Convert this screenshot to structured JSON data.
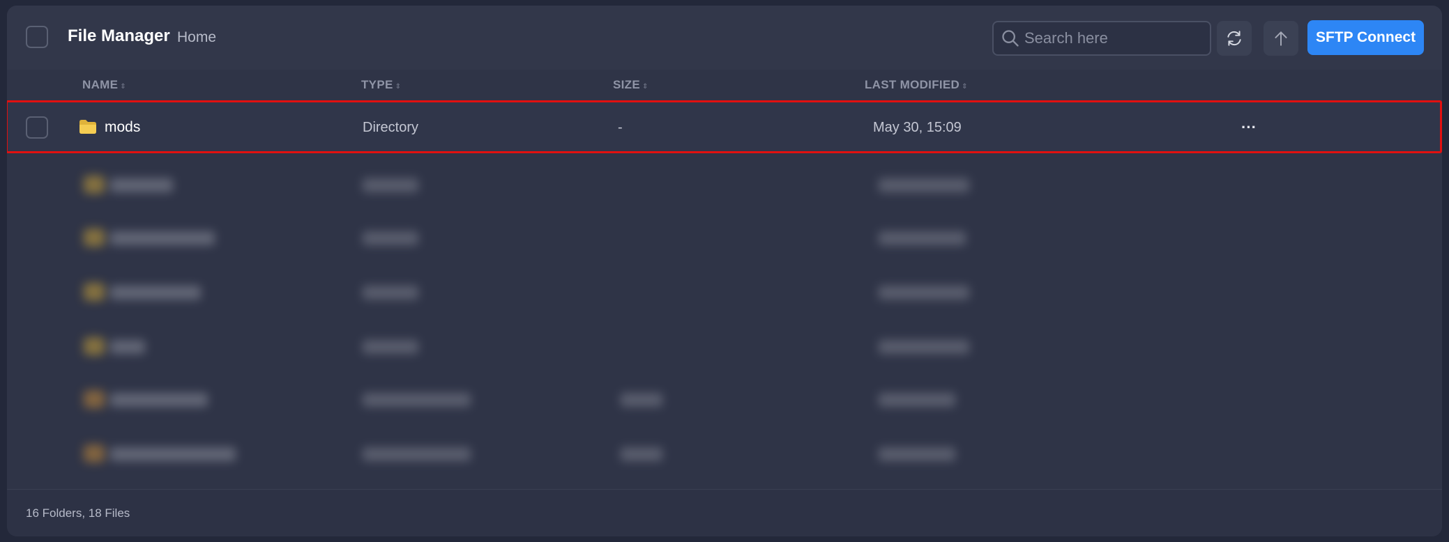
{
  "header": {
    "title": "File Manager",
    "breadcrumb": "Home",
    "search_placeholder": "Search here",
    "sftp_label": "SFTP Connect"
  },
  "columns": {
    "name": "NAME",
    "type": "TYPE",
    "size": "SIZE",
    "modified": "LAST MODIFIED"
  },
  "rows": [
    {
      "name": "mods",
      "type": "Directory",
      "size": "-",
      "modified": "May 30, 15:09",
      "icon": "folder-icon",
      "more": "···"
    }
  ],
  "footer": {
    "summary": "16 Folders, 18 Files"
  },
  "colors": {
    "accent": "#2d86f5",
    "highlight": "#e11010",
    "folder": "#f2c94c"
  }
}
